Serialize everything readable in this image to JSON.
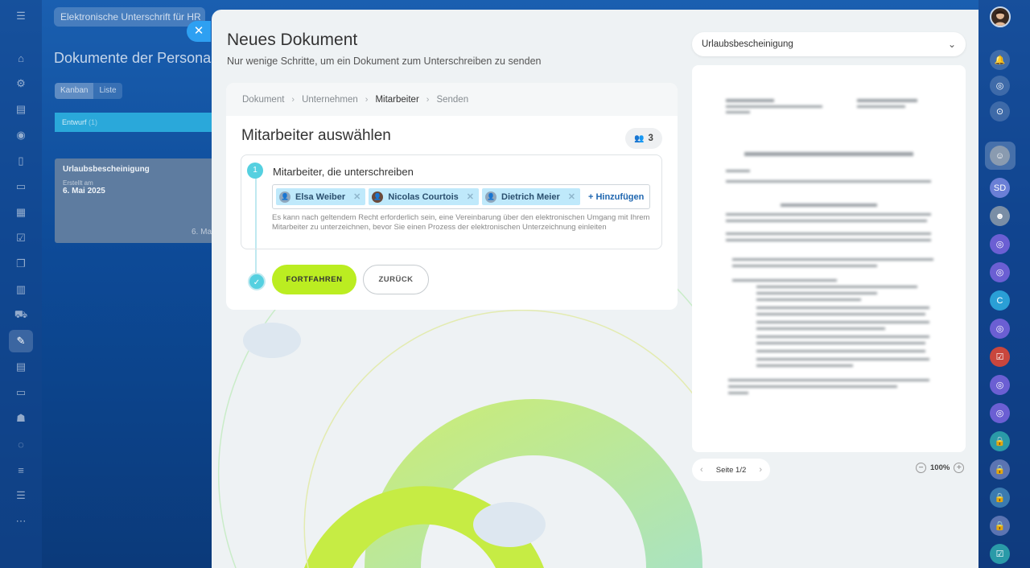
{
  "background": {
    "search_text": "Elektronische Unterschrift für HR",
    "page_title": "Dokumente der Personalabteilung",
    "view_tabs": [
      "Kanban",
      "Liste"
    ],
    "column_header": "Entwurf",
    "column_count": "(1)",
    "card": {
      "title": "Urlaubsbescheinigung",
      "created_label": "Erstellt am",
      "created_date": "6. Mai 2025",
      "date_partial": "6. Ma"
    }
  },
  "panel": {
    "title": "Neues Dokument",
    "subtitle": "Nur wenige Schritte, um ein Dokument zum Unterschreiben zu senden",
    "breadcrumb": [
      "Dokument",
      "Unternehmen",
      "Mitarbeiter",
      "Senden"
    ],
    "current_step": "Mitarbeiter",
    "section_title": "Mitarbeiter auswählen",
    "employee_count": "3",
    "step": {
      "number": "1",
      "label": "Mitarbeiter, die unterschreiben",
      "signers": [
        {
          "name": "Elsa Weiber"
        },
        {
          "name": "Nicolas Courtois"
        },
        {
          "name": "Dietrich Meier"
        }
      ],
      "add_link": "+ Hinzufügen",
      "hint": "Es kann nach geltendem Recht erforderlich sein, eine Vereinbarung über den elektronischen Umgang mit Ihrem Mitarbeiter zu unterzeichnen, bevor Sie einen Prozess der elektronischen Unterzeichnung einleiten"
    },
    "continue_button": "FORTFAHREN",
    "back_button": "ZURÜCK"
  },
  "preview": {
    "document_select": "Urlaubsbescheinigung",
    "page_indicator": "Seite 1/2",
    "zoom": "100%"
  },
  "right_rail": {
    "avatar_initials": [
      "SD",
      "C"
    ]
  },
  "colors": {
    "accent_green": "#bbed21",
    "step_cyan": "#55d0e0",
    "link_blue": "#2067b0",
    "tag_blue": "#bfe9fb",
    "close_blue": "#2ea0f2"
  },
  "icons": [
    "menu-icon",
    "close-icon",
    "chevron-down-icon",
    "bell-icon",
    "user-group-icon",
    "check-icon",
    "lock-icon"
  ]
}
